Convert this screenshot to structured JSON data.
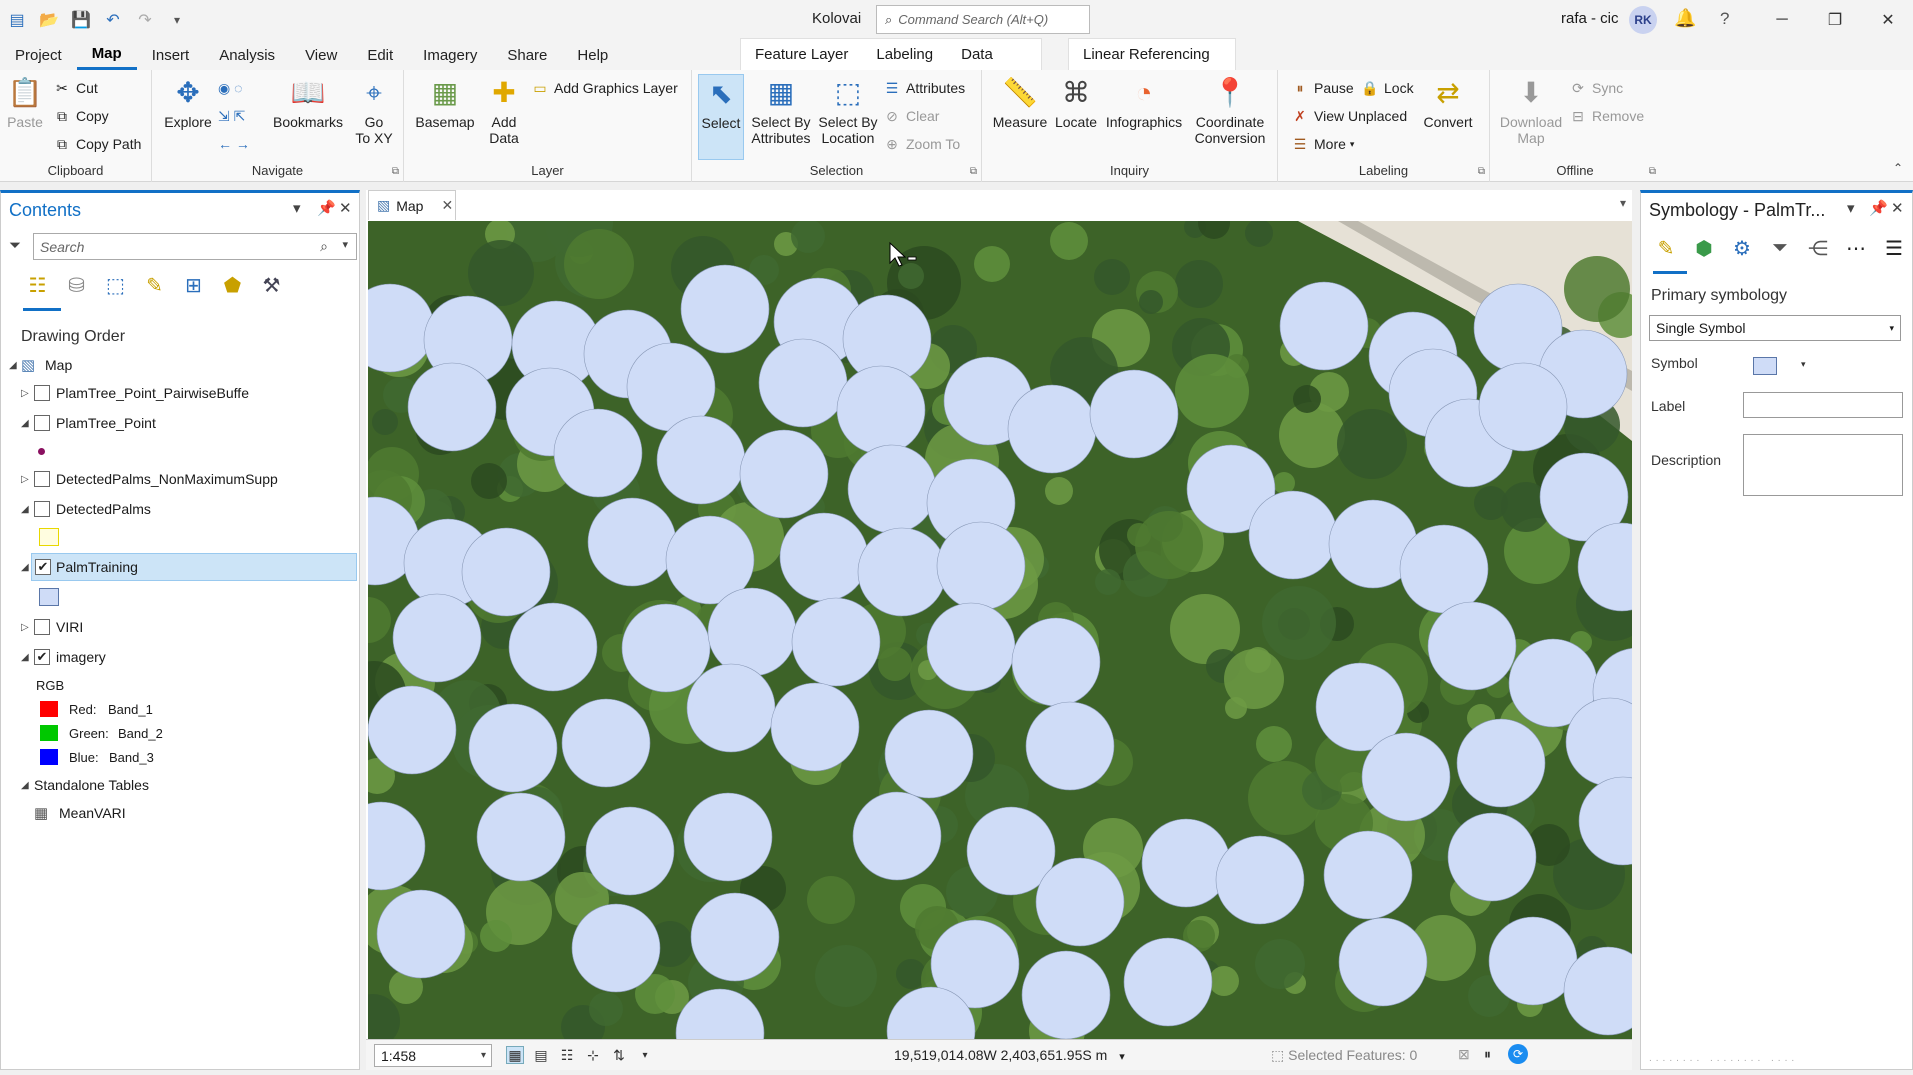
{
  "titlebar": {
    "project_name": "Kolovai",
    "command_search_placeholder": "Command Search (Alt+Q)",
    "user": "rafa - cic",
    "avatar_initials": "RK",
    "help": "?"
  },
  "tabs": [
    "Project",
    "Map",
    "Insert",
    "Analysis",
    "View",
    "Edit",
    "Imagery",
    "Share",
    "Help"
  ],
  "active_tab": "Map",
  "contextual_tabs": {
    "feature_layer_group": [
      "Feature Layer",
      "Labeling",
      "Data"
    ],
    "linear_referencing": "Linear Referencing"
  },
  "ribbon": {
    "clipboard": {
      "label": "Clipboard",
      "paste": "Paste",
      "cut": "Cut",
      "copy": "Copy",
      "copy_path": "Copy Path"
    },
    "navigate": {
      "label": "Navigate",
      "explore": "Explore",
      "bookmarks": "Bookmarks",
      "go_to_xy": "Go\nTo XY"
    },
    "layer": {
      "label": "Layer",
      "basemap": "Basemap",
      "add_data": "Add\nData",
      "add_graphics_layer": "Add Graphics Layer"
    },
    "selection": {
      "label": "Selection",
      "select": "Select",
      "select_by_attributes": "Select By\nAttributes",
      "select_by_location": "Select By\nLocation",
      "attributes": "Attributes",
      "clear": "Clear",
      "zoom_to": "Zoom To"
    },
    "inquiry": {
      "label": "Inquiry",
      "measure": "Measure",
      "locate": "Locate",
      "infographics": "Infographics",
      "coordinate_conversion": "Coordinate\nConversion"
    },
    "labeling": {
      "label": "Labeling",
      "pause": "Pause",
      "lock": "Lock",
      "view_unplaced": "View Unplaced",
      "more": "More",
      "convert": "Convert"
    },
    "offline": {
      "label": "Offline",
      "download_map": "Download\nMap",
      "sync": "Sync",
      "remove": "Remove"
    }
  },
  "contents": {
    "title": "Contents",
    "search_placeholder": "Search",
    "drawing_order": "Drawing Order",
    "map": "Map",
    "layers": [
      {
        "name": "PlamTree_Point_PairwiseBuffe",
        "checked": false,
        "expanded": false
      },
      {
        "name": "PlamTree_Point",
        "checked": false,
        "expanded": true
      },
      {
        "name": "DetectedPalms_NonMaximumSupp",
        "checked": false,
        "expanded": false
      },
      {
        "name": "DetectedPalms",
        "checked": false,
        "expanded": true
      },
      {
        "name": "PalmTraining",
        "checked": true,
        "expanded": true,
        "selected": true
      },
      {
        "name": "VIRI",
        "checked": false,
        "expanded": false
      },
      {
        "name": "imagery",
        "checked": true,
        "expanded": true
      }
    ],
    "rgb": "RGB",
    "bands": [
      {
        "label": "Red:",
        "band": "Band_1",
        "color": "#ff0000"
      },
      {
        "label": "Green:",
        "band": "Band_2",
        "color": "#00c800"
      },
      {
        "label": "Blue:",
        "band": "Band_3",
        "color": "#0000ff"
      }
    ],
    "standalone_tables": "Standalone Tables",
    "table": "MeanVARI"
  },
  "map_view": {
    "tab": "Map",
    "scale": "1:458",
    "coordinates": "19,519,014.08W 2,403,651.95S m",
    "selected_features": "Selected Features: 0",
    "circle_fill": "#cfdcf7"
  },
  "symbology": {
    "title": "Symbology - PalmTr...",
    "primary_symbology": "Primary symbology",
    "type": "Single Symbol",
    "symbol": "Symbol",
    "label": "Label",
    "description": "Description",
    "symbol_color": "#cfdcf7"
  },
  "colors": {
    "accent": "#1170c6",
    "selection": "#cce4f7"
  }
}
